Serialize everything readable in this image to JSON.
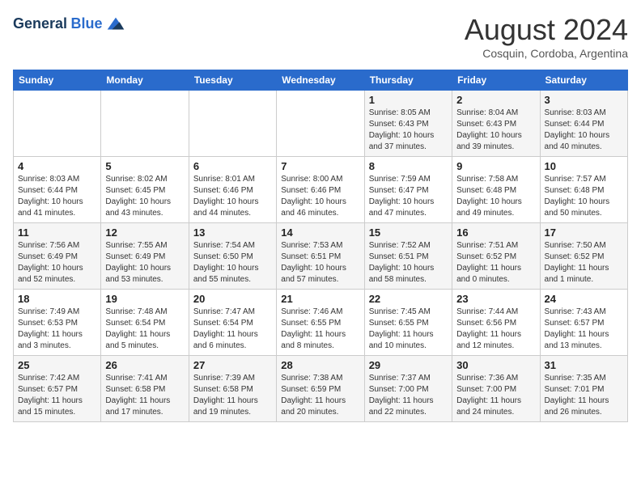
{
  "header": {
    "logo_line1": "General",
    "logo_line2": "Blue",
    "month_year": "August 2024",
    "location": "Cosquin, Cordoba, Argentina"
  },
  "days_of_week": [
    "Sunday",
    "Monday",
    "Tuesday",
    "Wednesday",
    "Thursday",
    "Friday",
    "Saturday"
  ],
  "weeks": [
    [
      {
        "day": "",
        "info": ""
      },
      {
        "day": "",
        "info": ""
      },
      {
        "day": "",
        "info": ""
      },
      {
        "day": "",
        "info": ""
      },
      {
        "day": "1",
        "info": "Sunrise: 8:05 AM\nSunset: 6:43 PM\nDaylight: 10 hours\nand 37 minutes."
      },
      {
        "day": "2",
        "info": "Sunrise: 8:04 AM\nSunset: 6:43 PM\nDaylight: 10 hours\nand 39 minutes."
      },
      {
        "day": "3",
        "info": "Sunrise: 8:03 AM\nSunset: 6:44 PM\nDaylight: 10 hours\nand 40 minutes."
      }
    ],
    [
      {
        "day": "4",
        "info": "Sunrise: 8:03 AM\nSunset: 6:44 PM\nDaylight: 10 hours\nand 41 minutes."
      },
      {
        "day": "5",
        "info": "Sunrise: 8:02 AM\nSunset: 6:45 PM\nDaylight: 10 hours\nand 43 minutes."
      },
      {
        "day": "6",
        "info": "Sunrise: 8:01 AM\nSunset: 6:46 PM\nDaylight: 10 hours\nand 44 minutes."
      },
      {
        "day": "7",
        "info": "Sunrise: 8:00 AM\nSunset: 6:46 PM\nDaylight: 10 hours\nand 46 minutes."
      },
      {
        "day": "8",
        "info": "Sunrise: 7:59 AM\nSunset: 6:47 PM\nDaylight: 10 hours\nand 47 minutes."
      },
      {
        "day": "9",
        "info": "Sunrise: 7:58 AM\nSunset: 6:48 PM\nDaylight: 10 hours\nand 49 minutes."
      },
      {
        "day": "10",
        "info": "Sunrise: 7:57 AM\nSunset: 6:48 PM\nDaylight: 10 hours\nand 50 minutes."
      }
    ],
    [
      {
        "day": "11",
        "info": "Sunrise: 7:56 AM\nSunset: 6:49 PM\nDaylight: 10 hours\nand 52 minutes."
      },
      {
        "day": "12",
        "info": "Sunrise: 7:55 AM\nSunset: 6:49 PM\nDaylight: 10 hours\nand 53 minutes."
      },
      {
        "day": "13",
        "info": "Sunrise: 7:54 AM\nSunset: 6:50 PM\nDaylight: 10 hours\nand 55 minutes."
      },
      {
        "day": "14",
        "info": "Sunrise: 7:53 AM\nSunset: 6:51 PM\nDaylight: 10 hours\nand 57 minutes."
      },
      {
        "day": "15",
        "info": "Sunrise: 7:52 AM\nSunset: 6:51 PM\nDaylight: 10 hours\nand 58 minutes."
      },
      {
        "day": "16",
        "info": "Sunrise: 7:51 AM\nSunset: 6:52 PM\nDaylight: 11 hours\nand 0 minutes."
      },
      {
        "day": "17",
        "info": "Sunrise: 7:50 AM\nSunset: 6:52 PM\nDaylight: 11 hours\nand 1 minute."
      }
    ],
    [
      {
        "day": "18",
        "info": "Sunrise: 7:49 AM\nSunset: 6:53 PM\nDaylight: 11 hours\nand 3 minutes."
      },
      {
        "day": "19",
        "info": "Sunrise: 7:48 AM\nSunset: 6:54 PM\nDaylight: 11 hours\nand 5 minutes."
      },
      {
        "day": "20",
        "info": "Sunrise: 7:47 AM\nSunset: 6:54 PM\nDaylight: 11 hours\nand 6 minutes."
      },
      {
        "day": "21",
        "info": "Sunrise: 7:46 AM\nSunset: 6:55 PM\nDaylight: 11 hours\nand 8 minutes."
      },
      {
        "day": "22",
        "info": "Sunrise: 7:45 AM\nSunset: 6:55 PM\nDaylight: 11 hours\nand 10 minutes."
      },
      {
        "day": "23",
        "info": "Sunrise: 7:44 AM\nSunset: 6:56 PM\nDaylight: 11 hours\nand 12 minutes."
      },
      {
        "day": "24",
        "info": "Sunrise: 7:43 AM\nSunset: 6:57 PM\nDaylight: 11 hours\nand 13 minutes."
      }
    ],
    [
      {
        "day": "25",
        "info": "Sunrise: 7:42 AM\nSunset: 6:57 PM\nDaylight: 11 hours\nand 15 minutes."
      },
      {
        "day": "26",
        "info": "Sunrise: 7:41 AM\nSunset: 6:58 PM\nDaylight: 11 hours\nand 17 minutes."
      },
      {
        "day": "27",
        "info": "Sunrise: 7:39 AM\nSunset: 6:58 PM\nDaylight: 11 hours\nand 19 minutes."
      },
      {
        "day": "28",
        "info": "Sunrise: 7:38 AM\nSunset: 6:59 PM\nDaylight: 11 hours\nand 20 minutes."
      },
      {
        "day": "29",
        "info": "Sunrise: 7:37 AM\nSunset: 7:00 PM\nDaylight: 11 hours\nand 22 minutes."
      },
      {
        "day": "30",
        "info": "Sunrise: 7:36 AM\nSunset: 7:00 PM\nDaylight: 11 hours\nand 24 minutes."
      },
      {
        "day": "31",
        "info": "Sunrise: 7:35 AM\nSunset: 7:01 PM\nDaylight: 11 hours\nand 26 minutes."
      }
    ]
  ]
}
